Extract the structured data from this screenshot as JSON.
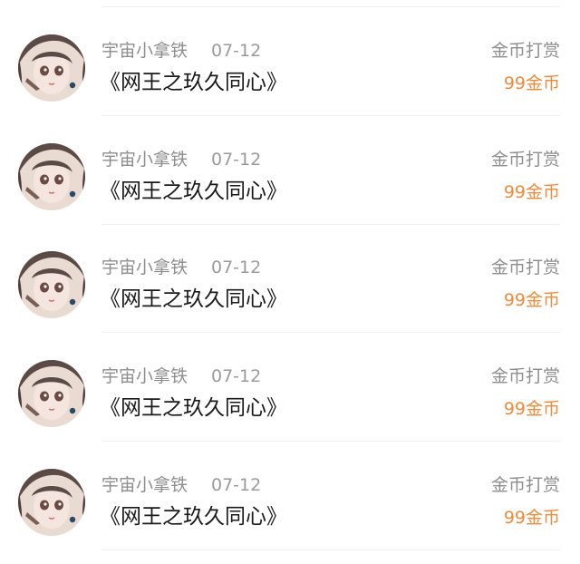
{
  "items": [
    {
      "username": "宇宙小拿铁",
      "date": "07-12",
      "title": "《网王之玖久同心》",
      "reward_label": "金币打赏",
      "reward_amount": "99金币"
    },
    {
      "username": "宇宙小拿铁",
      "date": "07-12",
      "title": "《网王之玖久同心》",
      "reward_label": "金币打赏",
      "reward_amount": "99金币"
    },
    {
      "username": "宇宙小拿铁",
      "date": "07-12",
      "title": "《网王之玖久同心》",
      "reward_label": "金币打赏",
      "reward_amount": "99金币"
    },
    {
      "username": "宇宙小拿铁",
      "date": "07-12",
      "title": "《网王之玖久同心》",
      "reward_label": "金币打赏",
      "reward_amount": "99金币"
    },
    {
      "username": "宇宙小拿铁",
      "date": "07-12",
      "title": "《网王之玖久同心》",
      "reward_label": "金币打赏",
      "reward_amount": "99金币"
    }
  ],
  "colors": {
    "reward_amount": "#ef8a3a",
    "meta_text": "#8e8e8e",
    "title_text": "#1a1a1a",
    "divider": "#efefef"
  }
}
